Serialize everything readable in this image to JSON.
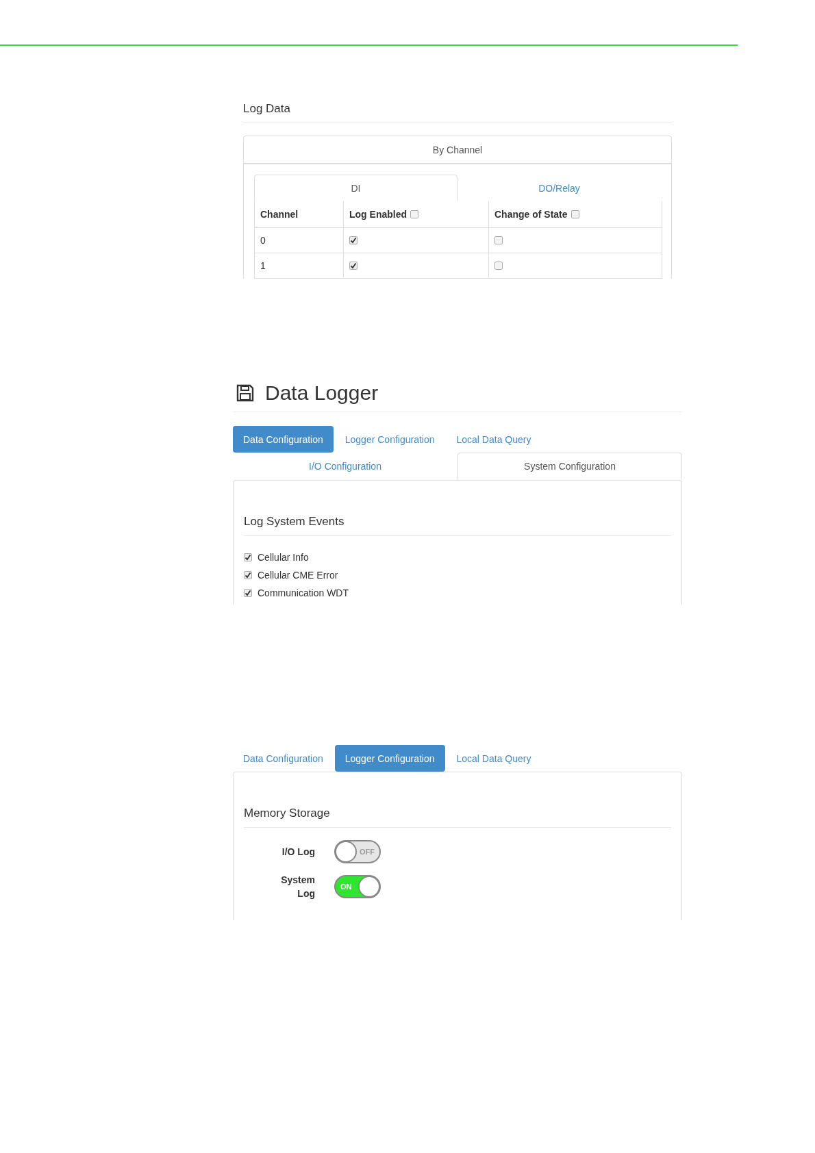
{
  "log_data": {
    "title": "Log Data",
    "panel_header": "By Channel",
    "tabs": [
      {
        "label": "DI",
        "selected": true
      },
      {
        "label": "DO/Relay",
        "selected": false
      }
    ],
    "columns": [
      {
        "label": "Channel"
      },
      {
        "label": "Log Enabled",
        "checked": false
      },
      {
        "label": "Change of State",
        "checked": false
      }
    ],
    "rows": [
      {
        "channel": "0",
        "log_enabled": true,
        "change_of_state": false
      },
      {
        "channel": "1",
        "log_enabled": true,
        "change_of_state": false
      }
    ]
  },
  "data_logger": {
    "title": "Data Logger",
    "tabs": [
      {
        "label": "Data Configuration",
        "selected": true
      },
      {
        "label": "Logger Configuration",
        "selected": false
      },
      {
        "label": "Local Data Query",
        "selected": false
      }
    ],
    "subtabs": [
      {
        "label": "I/O Configuration",
        "selected": false
      },
      {
        "label": "System Configuration",
        "selected": true
      }
    ],
    "section_title": "Log System Events",
    "events": [
      {
        "label": "Cellular Info",
        "checked": true
      },
      {
        "label": "Cellular CME Error",
        "checked": true
      },
      {
        "label": "Communication WDT",
        "checked": true
      }
    ]
  },
  "logger_config": {
    "tabs": [
      {
        "label": "Data Configuration",
        "selected": false
      },
      {
        "label": "Logger Configuration",
        "selected": true
      },
      {
        "label": "Local Data Query",
        "selected": false
      }
    ],
    "section_title": "Memory Storage",
    "toggles": [
      {
        "label": "I/O Log",
        "on": false,
        "state_text": "OFF"
      },
      {
        "label": "System Log",
        "on": true,
        "state_text": "ON"
      }
    ]
  }
}
